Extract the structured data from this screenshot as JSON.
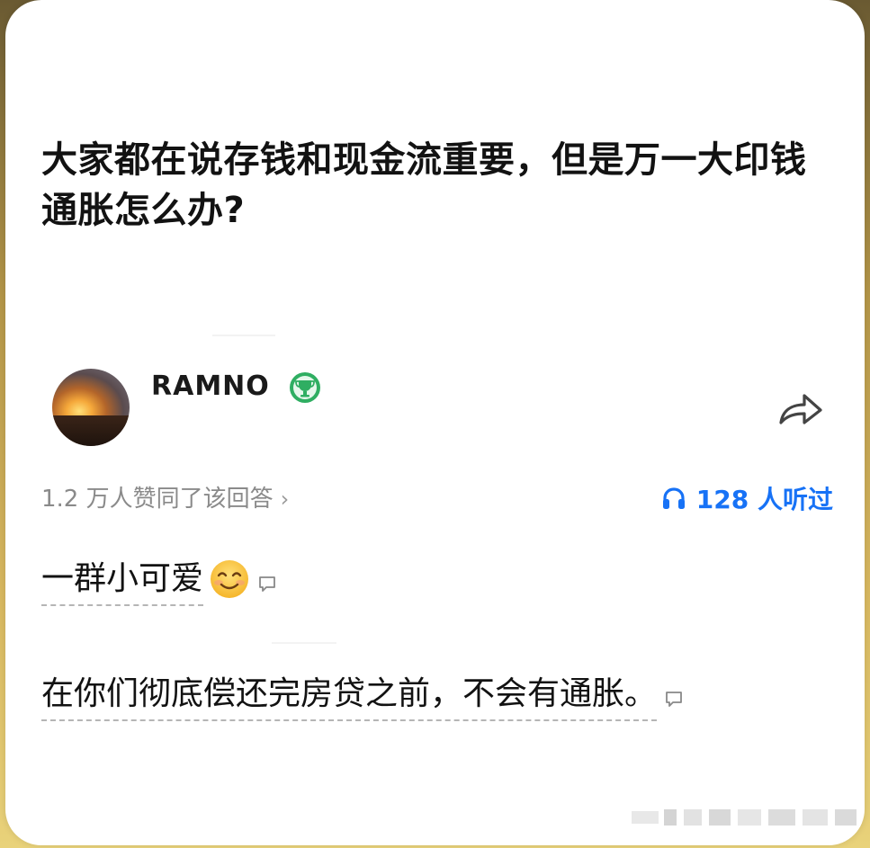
{
  "question": {
    "title": "大家都在说存钱和现金流重要，但是万一大印钱通胀怎么办?"
  },
  "author": {
    "name": "RAMNO",
    "badge_icon": "trophy-badge-icon",
    "avatar_icon": "sunset-avatar"
  },
  "share": {
    "icon": "share-arrow-icon"
  },
  "votes": {
    "text": "1.2 万人赞同了该回答",
    "chevron": "›"
  },
  "listen": {
    "icon": "headphone-icon",
    "text": "128 人听过",
    "color": "#1772f6"
  },
  "answer": {
    "paragraphs": [
      {
        "text": "一群小可爱",
        "emoji": "smile-emoji"
      },
      {
        "text": "在你们彻底偿还完房贷之前，不会有通胀。"
      }
    ]
  }
}
